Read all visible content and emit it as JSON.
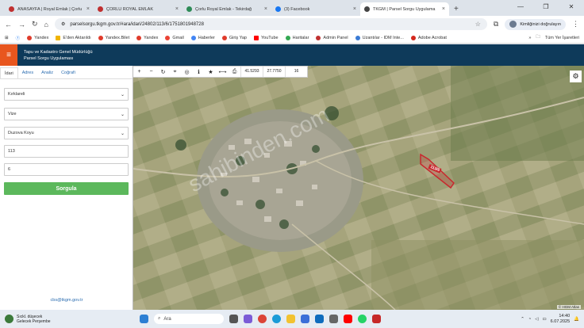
{
  "browser": {
    "tabs": [
      {
        "title": "ANASAYFA | Royal Emlak | Çorlu",
        "color": "#c03030"
      },
      {
        "title": "ÇORLU ROYAL EMLAK",
        "color": "#c03030"
      },
      {
        "title": "Çorlu Royal Emlak - Tekirdağ",
        "color": "#2e8b57"
      },
      {
        "title": "(3) Facebook",
        "color": "#1877f2"
      },
      {
        "title": "TKGM | Parsel Sorgu Uygulama",
        "color": "#444444"
      }
    ],
    "url": "parselsorgu.tkgm.gov.tr/#ara/idari/24802/113/6/1751801948728",
    "profile_label": "Kimliğinizi doğrulayın",
    "bookmarks": [
      {
        "label": "Yandex",
        "color": "#e03b2b"
      },
      {
        "label": "E'den Aktarıldı",
        "color": "#f0b400"
      },
      {
        "label": "Yandex.Bilet",
        "color": "#e03b2b"
      },
      {
        "label": "Yandex",
        "color": "#e03b2b"
      },
      {
        "label": "Gmail",
        "color": "#ea4335"
      },
      {
        "label": "Haberler",
        "color": "#4285f4"
      },
      {
        "label": "Giriş Yap",
        "color": "#e03b2b"
      },
      {
        "label": "YouTube",
        "color": "#ff0000"
      },
      {
        "label": "Haritalar",
        "color": "#34a853"
      },
      {
        "label": "Admin Panel",
        "color": "#c03030"
      },
      {
        "label": "Uzantılar - IDM Inte...",
        "color": "#3a7bd5"
      },
      {
        "label": "Adobe Acrobat",
        "color": "#d4281d"
      }
    ],
    "all_bookmarks": "Tüm Yer İşaretleri"
  },
  "header": {
    "line1": "Tapu ve Kadastro Genel Müdürlüğü",
    "line2": "Parsel Sorgu Uygulaması"
  },
  "panel": {
    "tabs": [
      "İdari",
      "Adres",
      "Analiz",
      "Coğrafi"
    ],
    "province": "Kırklareli",
    "district": "Vize",
    "village": "Duzova Koyu",
    "block": "113",
    "parcel": "6",
    "submit_label": "Sorgula",
    "email": "cbs@tkgm.gov.tr"
  },
  "map": {
    "coord_x": "41.5293",
    "coord_y": "27.7750",
    "zoom": "16",
    "parcel_label": "113/6",
    "watermark": "sahibinden.com",
    "attribution": "© HGM Atlas"
  },
  "taskbar": {
    "weather_title": "Sıckl. düşecek",
    "weather_sub": "Gelecek Perşembe",
    "search_label": "Ara",
    "time": "14:40",
    "date": "6.07.2025"
  }
}
